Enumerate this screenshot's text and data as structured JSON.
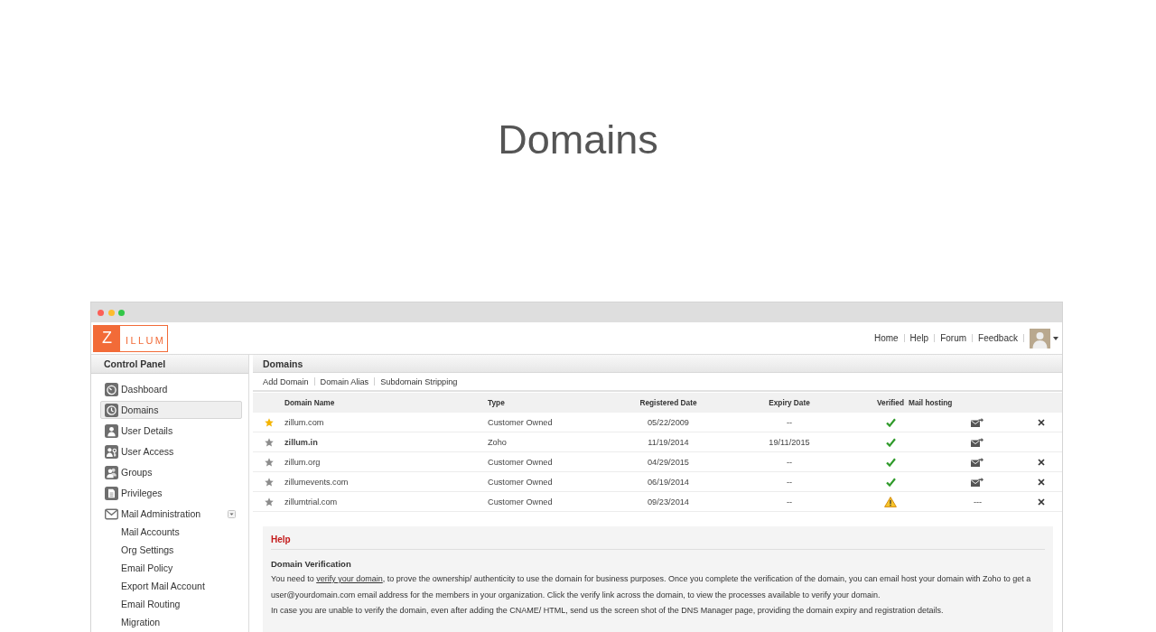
{
  "page_title": "Domains",
  "header": {
    "logo": {
      "initial": "Z",
      "name": "ILLUM"
    },
    "nav": [
      "Home",
      "Help",
      "Forum",
      "Feedback"
    ]
  },
  "sidebar": {
    "title": "Control Panel",
    "items": [
      {
        "label": "Dashboard",
        "selected": false
      },
      {
        "label": "Domains",
        "selected": true
      },
      {
        "label": "User Details",
        "selected": false
      },
      {
        "label": "User Access",
        "selected": false
      },
      {
        "label": "Groups",
        "selected": false
      },
      {
        "label": "Privileges",
        "selected": false
      },
      {
        "label": "Mail Administration",
        "selected": false,
        "expanded": true,
        "children": [
          {
            "label": "Mail Accounts",
            "selected": false
          },
          {
            "label": "Org Settings",
            "selected": false
          },
          {
            "label": "Email Policy",
            "selected": false
          },
          {
            "label": "Export Mail Account",
            "selected": false
          },
          {
            "label": "Email Routing",
            "selected": false
          },
          {
            "label": "Migration",
            "selected": false
          }
        ]
      }
    ]
  },
  "main": {
    "title": "Domains",
    "actions": [
      "Add Domain",
      "Domain Alias",
      "Subdomain Stripping"
    ],
    "table": {
      "columns": [
        "Domain Name",
        "Type",
        "Registered Date",
        "Expiry Date",
        "Verified",
        "Mail hosting"
      ],
      "rows": [
        {
          "primary": true,
          "domain": "zillum.com",
          "emphasized": false,
          "type": "Customer Owned",
          "registered": "05/22/2009",
          "expiry": "--",
          "verified": true,
          "mail_hosting": {
            "kind": "icon"
          },
          "deletable": true
        },
        {
          "primary": false,
          "domain": "zillum.in",
          "emphasized": true,
          "type": "Zoho",
          "registered": "11/19/2014",
          "expiry": "19/11/2015",
          "verified": true,
          "mail_hosting": {
            "kind": "icon"
          },
          "deletable": false
        },
        {
          "primary": false,
          "domain": "zillum.org",
          "emphasized": false,
          "type": "Customer Owned",
          "registered": "04/29/2015",
          "expiry": "--",
          "verified": true,
          "mail_hosting": {
            "kind": "icon"
          },
          "deletable": true
        },
        {
          "primary": false,
          "domain": "zillumevents.com",
          "emphasized": false,
          "type": "Customer Owned",
          "registered": "06/19/2014",
          "expiry": "--",
          "verified": true,
          "mail_hosting": {
            "kind": "icon"
          },
          "deletable": true
        },
        {
          "primary": false,
          "domain": "zillumtrial.com",
          "emphasized": false,
          "type": "Customer Owned",
          "registered": "09/23/2014",
          "expiry": "--",
          "verified": false,
          "mail_hosting": {
            "kind": "text",
            "text": "---"
          },
          "deletable": true
        }
      ]
    },
    "help": {
      "title": "Help",
      "heading": "Domain Verification",
      "paragraphs": [
        {
          "text": "You need to ",
          "link": "verify your domain",
          "after": ", to prove the ownership/ authenticity to use the domain for business purposes. Once you complete the verification of the domain, you can email host your domain with Zoho to get a user@yourdomain.com email address for the members in your organization. Click the verify link across the domain, to view the processes available to verify your domain."
        },
        {
          "text": "In case you are unable to verify the domain, even after adding the CNAME/ HTML, send us the screen shot of the DNS Manager page, providing the domain expiry and registration details."
        }
      ]
    }
  }
}
